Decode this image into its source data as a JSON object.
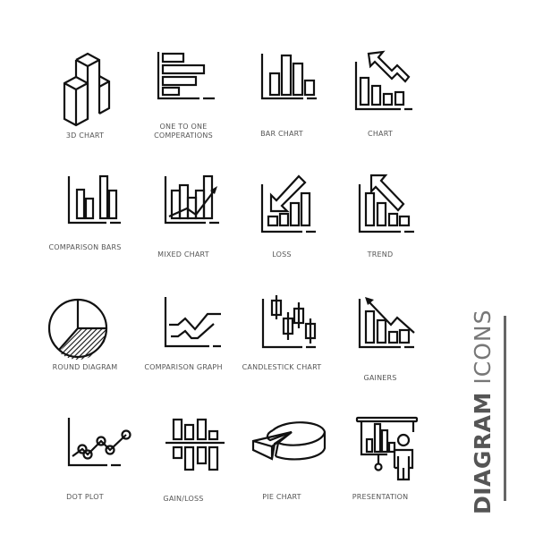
{
  "title": {
    "bold": "DIAGRAM",
    "light": "ICONS"
  },
  "icons": [
    {
      "name": "3d-chart",
      "label": "3D CHART"
    },
    {
      "name": "one-to-one-comperations",
      "label": "ONE TO ONE COMPERATIONS"
    },
    {
      "name": "bar-chart",
      "label": "BAR CHART"
    },
    {
      "name": "chart",
      "label": "CHART"
    },
    {
      "name": "comparison-bars",
      "label": "COMPARISON BARS"
    },
    {
      "name": "mixed-chart",
      "label": "MIXED CHART"
    },
    {
      "name": "loss",
      "label": "LOSS"
    },
    {
      "name": "trend",
      "label": "TREND"
    },
    {
      "name": "round-diagram",
      "label": "ROUND DIAGRAM"
    },
    {
      "name": "comparison-graph",
      "label": "COMPARISON GRAPH"
    },
    {
      "name": "candlestick-chart",
      "label": "CANDLESTICK CHART"
    },
    {
      "name": "gainers",
      "label": "GAINERS"
    },
    {
      "name": "dot-plot",
      "label": "DOT PLOT"
    },
    {
      "name": "gain-loss",
      "label": "GAIN/LOSS"
    },
    {
      "name": "pie-chart",
      "label": "PIE CHART"
    },
    {
      "name": "presentation",
      "label": "PRESENTATION"
    }
  ],
  "colors": {
    "icon_stroke": "#111111",
    "label_text": "#555555",
    "title_text": "#555555",
    "background": "#ffffff"
  }
}
